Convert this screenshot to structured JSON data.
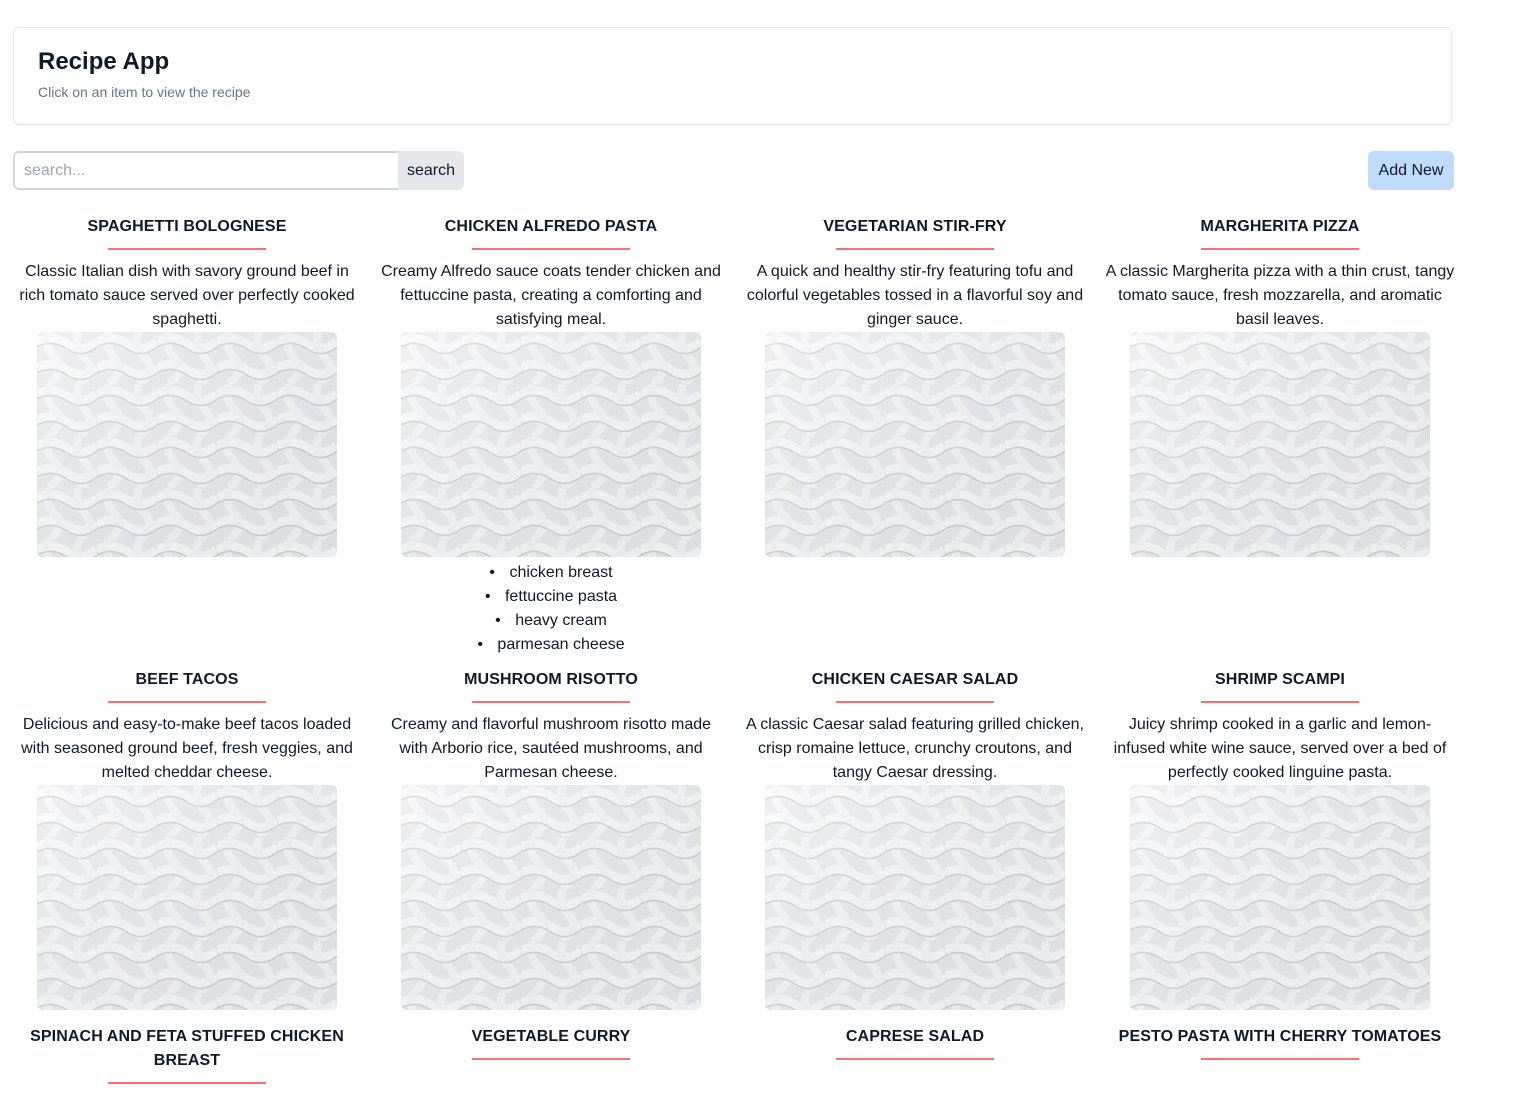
{
  "header": {
    "title": "Recipe App",
    "subtitle": "Click on an item to view the recipe"
  },
  "search": {
    "placeholder": "search...",
    "value": "",
    "button_label": "search"
  },
  "add_button_label": "Add New",
  "recipes": [
    {
      "title": "Spaghetti Bolognese",
      "description": "Classic Italian dish with savory ground beef in rich tomato sauce served over perfectly cooked spaghetti."
    },
    {
      "title": "Chicken Alfredo Pasta",
      "description": "Creamy Alfredo sauce coats tender chicken and fettuccine pasta, creating a comforting and satisfying meal.",
      "ingredients": [
        "chicken breast",
        "fettuccine pasta",
        "heavy cream",
        "parmesan cheese"
      ]
    },
    {
      "title": "Vegetarian Stir-Fry",
      "description": "A quick and healthy stir-fry featuring tofu and colorful vegetables tossed in a flavorful soy and ginger sauce."
    },
    {
      "title": "Margherita Pizza",
      "description": "A classic Margherita pizza with a thin crust, tangy tomato sauce, fresh mozzarella, and aromatic basil leaves."
    },
    {
      "title": "Beef Tacos",
      "description": "Delicious and easy-to-make beef tacos loaded with seasoned ground beef, fresh veggies, and melted cheddar cheese."
    },
    {
      "title": "Mushroom Risotto",
      "description": "Creamy and flavorful mushroom risotto made with Arborio rice, sautéed mushrooms, and Parmesan cheese."
    },
    {
      "title": "Chicken Caesar Salad",
      "description": "A classic Caesar salad featuring grilled chicken, crisp romaine lettuce, crunchy croutons, and tangy Caesar dressing."
    },
    {
      "title": "Shrimp Scampi",
      "description": "Juicy shrimp cooked in a garlic and lemon-infused white wine sauce, served over a bed of perfectly cooked linguine pasta."
    },
    {
      "title": "Spinach and Feta Stuffed Chicken Breast",
      "description": ""
    },
    {
      "title": "Vegetable Curry",
      "description": ""
    },
    {
      "title": "Caprese Salad",
      "description": ""
    },
    {
      "title": "Pesto Pasta with Cherry Tomatoes",
      "description": ""
    }
  ]
}
